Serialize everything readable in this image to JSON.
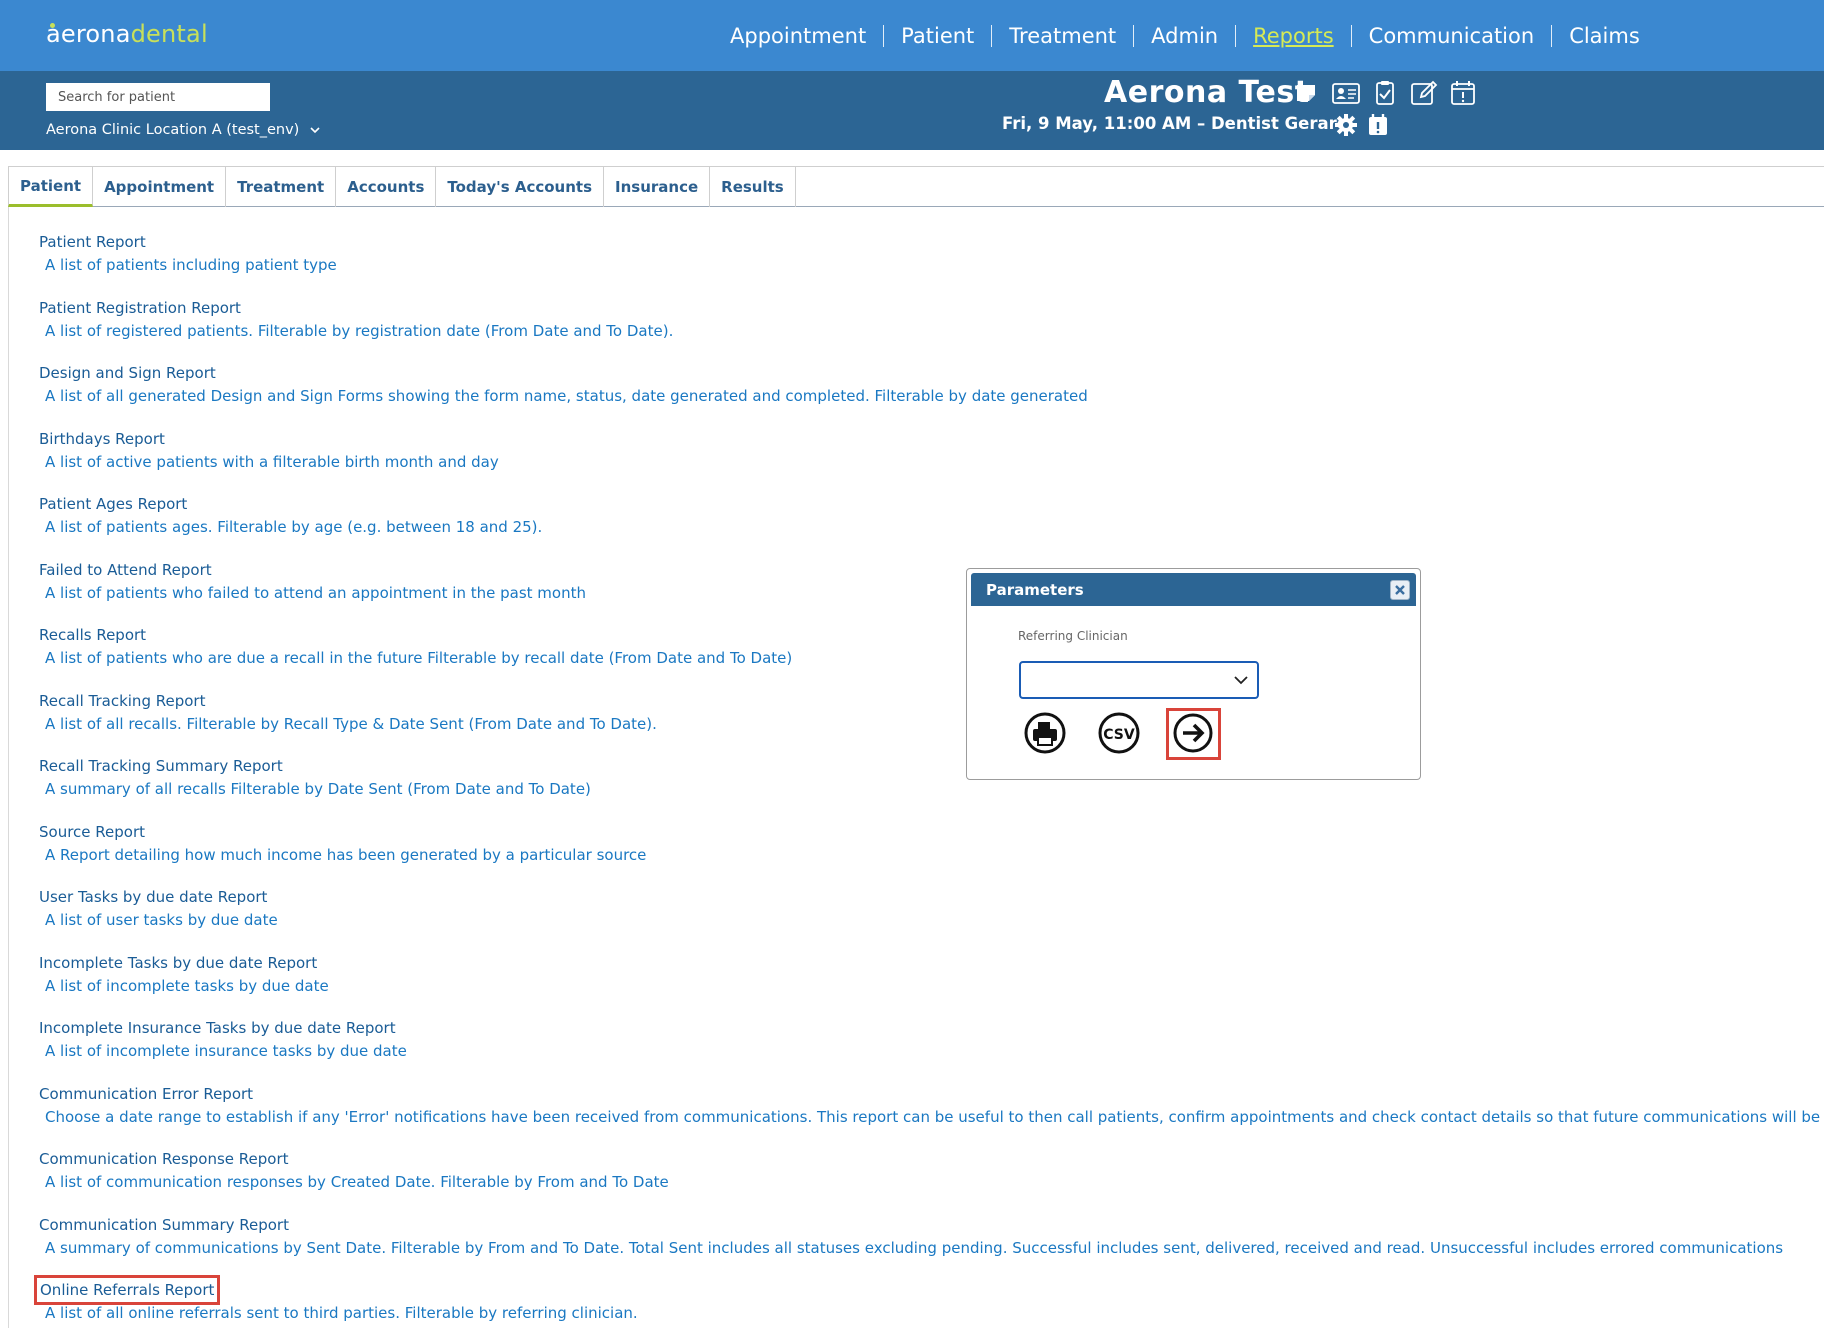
{
  "app": {
    "logo_part1": "aerona",
    "logo_part2": "dental"
  },
  "nav": {
    "items": [
      {
        "label": "Appointment"
      },
      {
        "label": "Patient"
      },
      {
        "label": "Treatment"
      },
      {
        "label": "Admin"
      },
      {
        "label": "Reports",
        "active": true
      },
      {
        "label": "Communication"
      },
      {
        "label": "Claims"
      }
    ]
  },
  "context": {
    "search_placeholder": "Search for patient",
    "location": "Aerona Clinic Location A (test_env)",
    "patient_name": "Aerona Test",
    "appointment": "Fri, 9 May, 11:00 AM –  Dentist Gerard",
    "patient_icons": [
      "sticky-note-icon",
      "contact-card-icon",
      "clipboard-check-icon",
      "edit-icon",
      "calendar-icon"
    ],
    "appointment_icons": [
      "gear-icon",
      "calendar-alert-icon"
    ]
  },
  "tabs": [
    {
      "label": "Patient",
      "active": true
    },
    {
      "label": "Appointment"
    },
    {
      "label": "Treatment"
    },
    {
      "label": "Accounts"
    },
    {
      "label": "Today's Accounts"
    },
    {
      "label": "Insurance"
    },
    {
      "label": "Results"
    }
  ],
  "reports": [
    {
      "title": "Patient Report",
      "desc": "A list of patients including patient type"
    },
    {
      "title": "Patient Registration Report",
      "desc": "A list of registered patients. Filterable by registration date (From Date and To Date)."
    },
    {
      "title": "Design and Sign Report",
      "desc": "A list of all generated Design and Sign Forms showing the form name, status, date generated and completed. Filterable by date generated"
    },
    {
      "title": "Birthdays Report",
      "desc": "A list of active patients with a filterable birth month and day"
    },
    {
      "title": "Patient Ages Report",
      "desc": "A list of patients ages. Filterable by age (e.g. between 18 and 25)."
    },
    {
      "title": "Failed to Attend Report",
      "desc": "A list of patients who failed to attend an appointment in the past month"
    },
    {
      "title": "Recalls Report",
      "desc": "A list of patients who are due a recall in the future Filterable by recall date (From Date and To Date)"
    },
    {
      "title": "Recall Tracking Report",
      "desc": "A list of all recalls. Filterable by Recall Type & Date Sent (From Date and To Date)."
    },
    {
      "title": "Recall Tracking Summary Report",
      "desc": "A summary of all recalls Filterable by Date Sent (From Date and To Date)"
    },
    {
      "title": "Source Report",
      "desc": "A Report detailing how much income has been generated by a particular source"
    },
    {
      "title": "User Tasks by due date Report",
      "desc": "A list of user tasks by due date"
    },
    {
      "title": "Incomplete Tasks by due date Report",
      "desc": "A list of incomplete tasks by due date"
    },
    {
      "title": "Incomplete Insurance Tasks by due date Report",
      "desc": "A list of incomplete insurance tasks by due date"
    },
    {
      "title": "Communication Error Report",
      "desc": "Choose a date range to establish if any 'Error' notifications have been received from communications. This report can be useful to then call patients, confirm appointments and check contact details so that future communications will be successful"
    },
    {
      "title": "Communication Response Report",
      "desc": "A list of communication responses by Created Date. Filterable by From and To Date"
    },
    {
      "title": "Communication Summary Report",
      "desc": "A summary of communications by Sent Date. Filterable by From and To Date. Total Sent includes all statuses excluding pending. Successful includes sent, delivered, received and read. Unsuccessful includes errored communications"
    },
    {
      "title": "Online Referrals Report",
      "desc": "A list of all online referrals sent to third parties. Filterable by referring clinician.",
      "highlighted": true
    }
  ],
  "dialog": {
    "title": "Parameters",
    "field_label": "Referring Clinician",
    "field_value": "",
    "buttons": [
      "print-icon",
      "csv-icon",
      "arrow-right-icon"
    ],
    "csv_text": "CSV",
    "highlight_color": "#d9443a"
  },
  "colors": {
    "nav_bg": "#3b88d0",
    "context_bg": "#2c6594",
    "link_blue": "#1a78c2",
    "active_nav": "#d6ea55",
    "tab_active_underline": "#9bbe2c"
  }
}
